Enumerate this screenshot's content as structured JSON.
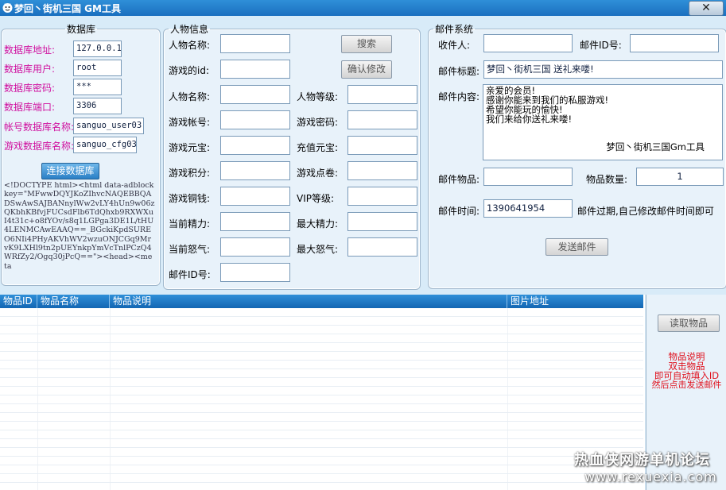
{
  "window": {
    "title": "梦回丶街机三国 GM工具",
    "close_label": "✕"
  },
  "database": {
    "group_title": "数据库",
    "fields": [
      {
        "label": "数据库地址:",
        "value": "127.0.0.1"
      },
      {
        "label": "数据库用户:",
        "value": "root"
      },
      {
        "label": "数据库密码:",
        "value": "***"
      },
      {
        "label": "数据库端口:",
        "value": "3306"
      },
      {
        "label": "帐号数据库名称:",
        "value": "sanguo_user03"
      },
      {
        "label": "游戏数据库名称:",
        "value": "sanguo_cfg03"
      }
    ],
    "connect_button": "连接数据库",
    "raw_text": "<!DOCTYPE html><html data-adblockkey=\"MFwwDQYJKoZIhvcNAQEBBQADSwAwSAJBANnylWw2vLY4hUn9w06zQKbhKBfvjFUCsdFlb6TdQhxb9RXWXuI4t31c+o8fYOv/s8q1LGPga3DE1L/tHU4LENMCAwEAAQ==_BGckiKpdSUREO6NIi4PHyAKVhWV2wzuONJCGq9MrvK9LXHl9tn2pUEYnkpYmVcTnlPCzQ4WRfZy2/Ogq30jPcQ==\"><head><meta"
  },
  "character": {
    "group_title": "人物信息",
    "search_name_label": "人物名称:",
    "game_id_label": "游戏的id:",
    "search_button": "搜索",
    "confirm_button": "确认修改",
    "left_labels": [
      "人物名称:",
      "游戏帐号:",
      "游戏元宝:",
      "游戏积分:",
      "游戏铜钱:",
      "当前精力:",
      "当前怒气:",
      "邮件ID号:"
    ],
    "right_labels": [
      "人物等级:",
      "游戏密码:",
      "充值元宝:",
      "游戏点卷:",
      "VIP等级:",
      "最大精力:",
      "最大怒气:"
    ]
  },
  "mail": {
    "group_title": "邮件系统",
    "recipient_label": "收件人:",
    "recipient_value": "",
    "mail_id_label": "邮件ID号:",
    "subject_label": "邮件标题:",
    "subject_value": "梦回丶街机三国 送礼来喽!",
    "content_label": "邮件内容:",
    "content_lines": [
      "亲爱的会员!",
      "感谢你能来到我们的私服游戏!",
      "希望你能玩的愉快!",
      "我们来给你送礼来喽!"
    ],
    "content_signature": "梦回丶街机三国Gm工具",
    "item_label": "邮件物品:",
    "qty_label": "物品数量:",
    "qty_value": "1",
    "time_label": "邮件时间:",
    "time_value": "1390641954",
    "time_note": "邮件过期,自己修改邮件时间即可",
    "send_button": "发送邮件"
  },
  "item_table": {
    "columns": [
      "物品ID",
      "物品名称",
      "物品说明",
      "图片地址"
    ],
    "rows": []
  },
  "side_panel": {
    "read_button": "读取物品",
    "help_lines": [
      "物品说明",
      "双击物品",
      "即可自动填入ID",
      "然后点击发送邮件"
    ]
  },
  "watermark": {
    "line1": "热血侠网游单机论坛",
    "line2": "www.rexuexia.com"
  },
  "colors": {
    "label_magenta": "#d0109f",
    "help_red": "#e0101c",
    "title_blue": "#1a6fbf"
  }
}
